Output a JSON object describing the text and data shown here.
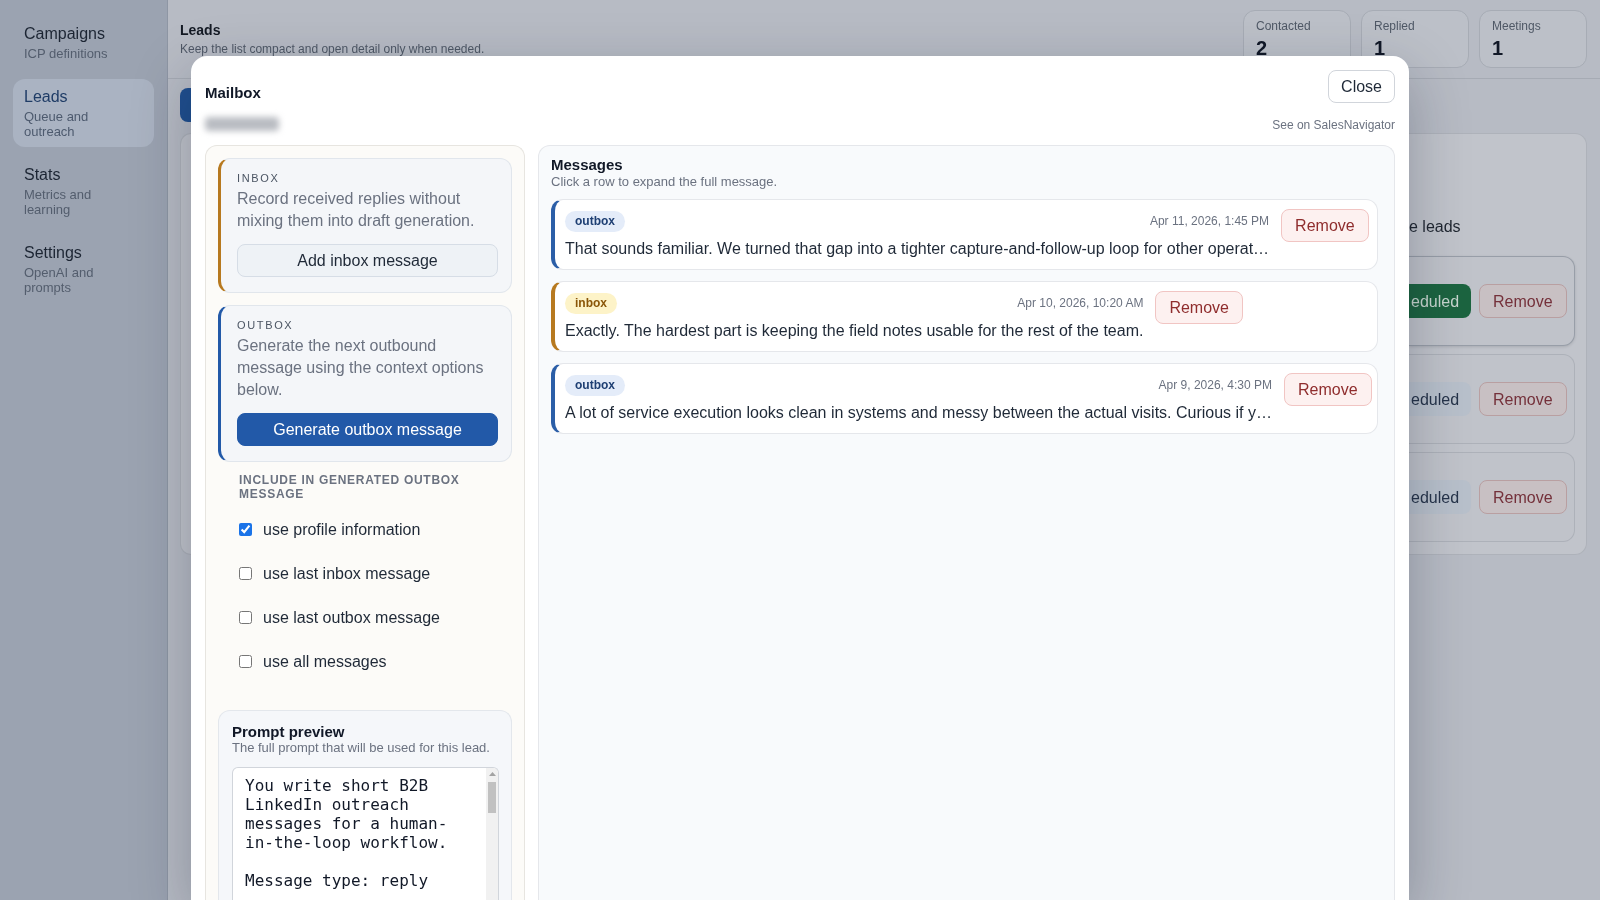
{
  "sidebar": {
    "items": [
      {
        "title": "Campaigns",
        "subtitle": "ICP definitions",
        "selected": false
      },
      {
        "title": "Leads",
        "subtitle": "Queue and outreach",
        "selected": true
      },
      {
        "title": "Stats",
        "subtitle": "Metrics and learning",
        "selected": false
      },
      {
        "title": "Settings",
        "subtitle": "OpenAI and prompts",
        "selected": false
      }
    ]
  },
  "header": {
    "title": "Leads",
    "subtitle": "Keep the list compact and open detail only when needed.",
    "stats": [
      {
        "label": "Contacted",
        "value": "2"
      },
      {
        "label": "Replied",
        "value": "1"
      },
      {
        "label": "Meetings",
        "value": "1"
      }
    ]
  },
  "leads_card": {
    "heading": "e leads",
    "rows": [
      {
        "status": "eduled",
        "active": true,
        "selected": true,
        "remove": "Remove"
      },
      {
        "status": "eduled",
        "active": false,
        "selected": false,
        "remove": "Remove"
      },
      {
        "status": "eduled",
        "active": false,
        "selected": false,
        "remove": "Remove"
      }
    ]
  },
  "mailbox": {
    "title": "Mailbox",
    "close": "Close",
    "link": "See on SalesNavigator",
    "composer": {
      "sections": [
        {
          "kind": "inbox",
          "label": "INBOX",
          "description": "Record received replies without mixing them into draft generation.",
          "button": "Add inbox message"
        },
        {
          "kind": "outbox",
          "label": "OUTBOX",
          "description": "Generate the next outbound message using the context options below.",
          "button": "Generate outbox message"
        }
      ],
      "include_heading": "INCLUDE IN GENERATED OUTBOX MESSAGE",
      "options": [
        {
          "label": "use profile information",
          "checked": true
        },
        {
          "label": "use last inbox message",
          "checked": false
        },
        {
          "label": "use last outbox message",
          "checked": false
        },
        {
          "label": "use all messages",
          "checked": false
        }
      ],
      "prompt_preview": {
        "title": "Prompt preview",
        "subtitle": "The full prompt that will be used for this lead.",
        "text": "You write short B2B LinkedIn outreach messages for a human-in-the-loop workflow.\n\nMessage type: reply"
      }
    },
    "messages": {
      "title": "Messages",
      "subtitle": "Click a row to expand the full message.",
      "items": [
        {
          "kind": "outbox",
          "badge": "outbox",
          "date": "Apr 11, 2026, 1:45 PM",
          "text": "That sounds familiar. We turned that gap into a tighter capture-and-follow-up loop for other operat…",
          "remove": "Remove"
        },
        {
          "kind": "inbox",
          "badge": "inbox",
          "date": "Apr 10, 2026, 10:20 AM",
          "text": "Exactly. The hardest part is keeping the field notes usable for the rest of the team.",
          "remove": "Remove"
        },
        {
          "kind": "outbox",
          "badge": "outbox",
          "date": "Apr 9, 2026, 4:30 PM",
          "text": "A lot of service execution looks clean in systems and messy between the actual visits. Curious if y…",
          "remove": "Remove"
        }
      ]
    }
  }
}
